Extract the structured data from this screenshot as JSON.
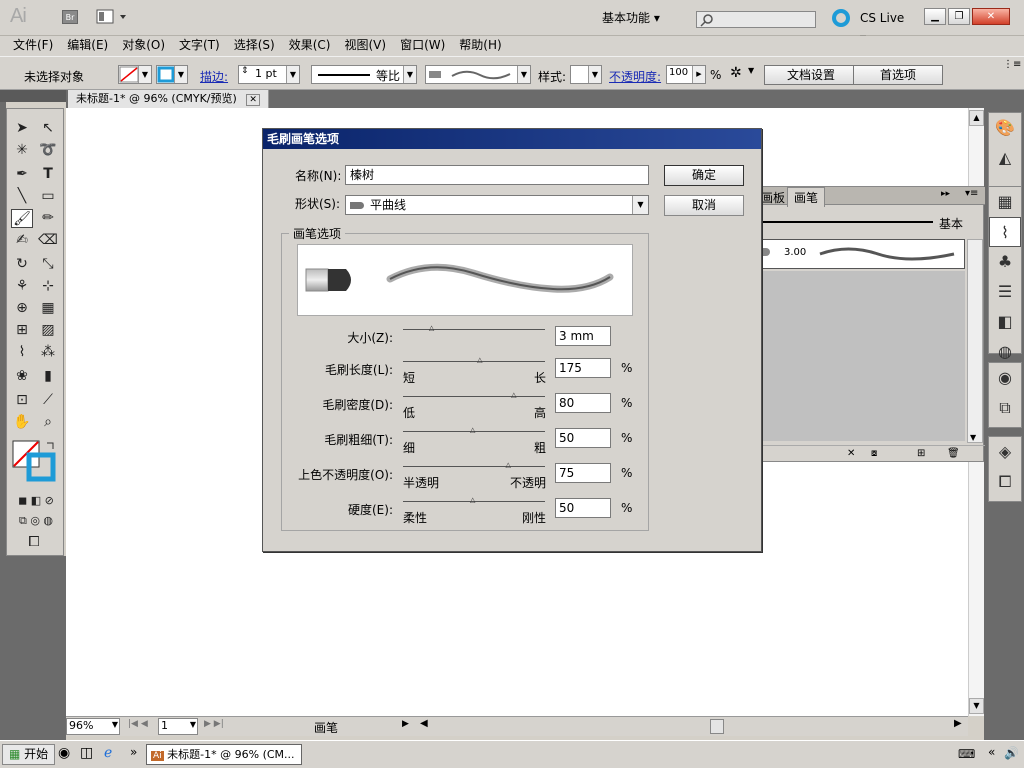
{
  "app": {
    "logo": "Ai",
    "bridge_label": "Br",
    "workspace_label": "基本功能",
    "search_placeholder": "",
    "cs_live_label": "CS Live"
  },
  "menus": [
    "文件(F)",
    "编辑(E)",
    "对象(O)",
    "文字(T)",
    "选择(S)",
    "效果(C)",
    "视图(V)",
    "窗口(W)",
    "帮助(H)"
  ],
  "control_bar": {
    "selection_status": "未选择对象",
    "stroke_label": "描边:",
    "stroke_weight": "1 pt",
    "stroke_profile": "等比",
    "style_label": "样式:",
    "opacity_label": "不透明度:",
    "opacity_value": "100",
    "opacity_unit": "%",
    "doc_setup_button": "文档设置",
    "preferences_button": "首选项"
  },
  "document": {
    "tab_title": "未标题-1* @ 96% (CMYK/预览)",
    "zoom": "96%",
    "artboard": "1",
    "status_text": "画笔"
  },
  "brush_panel": {
    "tab_artboards": "画板",
    "tab_brushes": "画笔",
    "basic_label": "基本",
    "brush_size": "3.00"
  },
  "dialog": {
    "title": "毛刷画笔选项",
    "name_label": "名称(N):",
    "name_value": "榛树",
    "shape_label": "形状(S):",
    "shape_value": "平曲线",
    "ok_button": "确定",
    "cancel_button": "取消",
    "group_label": "画笔选项",
    "rows": [
      {
        "label": "大小(Z):",
        "value": "3 mm",
        "low": "",
        "high": "",
        "unit": "",
        "position": 0.21
      },
      {
        "label": "毛刷长度(L):",
        "value": "175",
        "low": "短",
        "high": "长",
        "unit": "%",
        "position": 0.55
      },
      {
        "label": "毛刷密度(D):",
        "value": "80",
        "low": "低",
        "high": "高",
        "unit": "%",
        "position": 0.79
      },
      {
        "label": "毛刷粗细(T):",
        "value": "50",
        "low": "细",
        "high": "粗",
        "unit": "%",
        "position": 0.5
      },
      {
        "label": "上色不透明度(O):",
        "value": "75",
        "low": "半透明",
        "high": "不透明",
        "unit": "%",
        "position": 0.75
      },
      {
        "label": "硬度(E):",
        "value": "50",
        "low": "柔性",
        "high": "刚性",
        "unit": "%",
        "position": 0.5
      }
    ]
  },
  "taskbar": {
    "start_label": "开始",
    "window_label": "未标题-1* @ 96% (CM..."
  }
}
